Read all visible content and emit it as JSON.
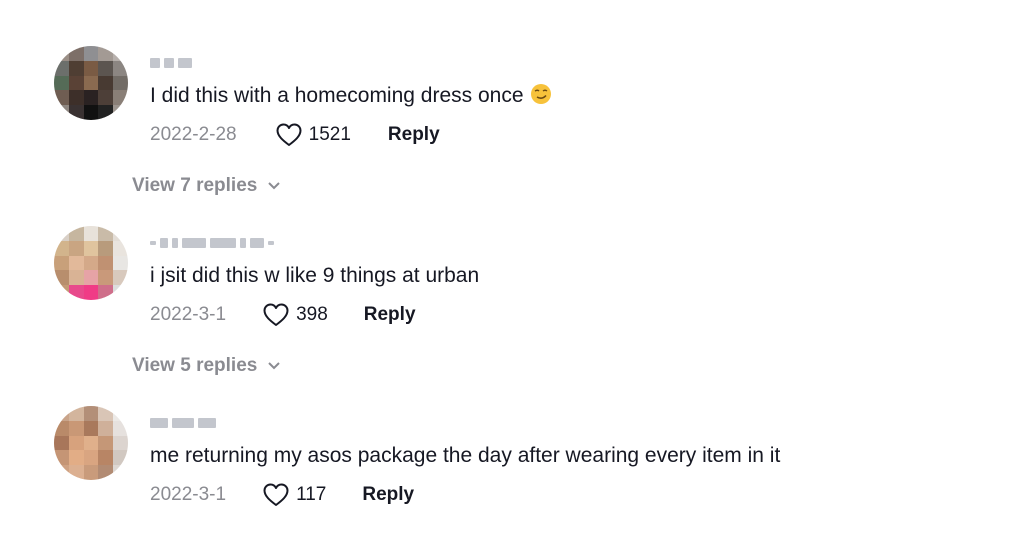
{
  "comments": [
    {
      "text": "I did this with a homecoming dress once",
      "emoji": "smirking-face-emoji",
      "date": "2022-2-28",
      "likes": "1521",
      "reply_label": "Reply",
      "view_replies": "View 7 replies"
    },
    {
      "text": "i jsit did this w like 9 things at urban",
      "date": "2022-3-1",
      "likes": "398",
      "reply_label": "Reply",
      "view_replies": "View 5 replies"
    },
    {
      "text": "me returning my asos package the day after wearing every item in it",
      "date": "2022-3-1",
      "likes": "117",
      "reply_label": "Reply"
    }
  ],
  "colors": {
    "text": "#161823",
    "muted": "#8a8b91",
    "background": "#ffffff"
  },
  "icons": {
    "like": "heart-outline-icon",
    "expand": "chevron-down-icon"
  }
}
